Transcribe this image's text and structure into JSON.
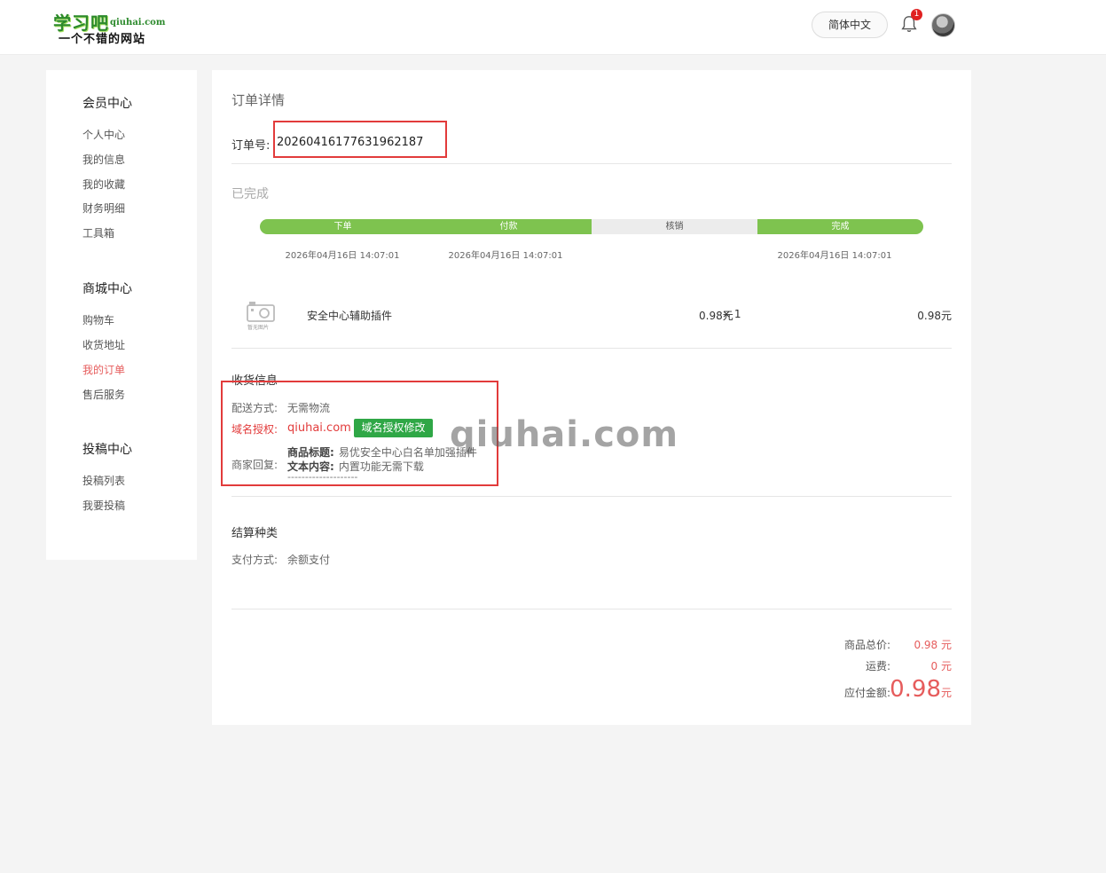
{
  "header": {
    "logo_main": "学习吧",
    "logo_domain": "qiuhai.com",
    "logo_slogan": "一个不错的网站",
    "language": "简体中文",
    "notification_count": "1"
  },
  "sidebar": {
    "groups": [
      {
        "title": "会员中心",
        "items": [
          "个人中心",
          "我的信息",
          "我的收藏",
          "财务明细",
          "工具箱"
        ]
      },
      {
        "title": "商城中心",
        "items": [
          "购物车",
          "收货地址",
          "我的订单",
          "售后服务"
        ]
      },
      {
        "title": "投稿中心",
        "items": [
          "投稿列表",
          "我要投稿"
        ]
      }
    ],
    "active_item": "我的订单"
  },
  "order": {
    "title": "订单详情",
    "order_no_label": "订单号:",
    "order_no": "20260416177631962187",
    "status": "已完成",
    "steps": [
      {
        "label": "下单",
        "time": "2026年04月16日 14:07:01",
        "done": true
      },
      {
        "label": "付款",
        "time": "2026年04月16日 14:07:01",
        "done": true
      },
      {
        "label": "核销",
        "time": "",
        "done": false
      },
      {
        "label": "完成",
        "time": "2026年04月16日 14:07:01",
        "done": true
      }
    ],
    "product": {
      "image_caption": "暂无图片",
      "name": "安全中心辅助插件",
      "unit_price": "0.98元",
      "quantity": "× 1",
      "total": "0.98元"
    }
  },
  "shipping": {
    "title": "收货信息",
    "delivery_label": "配送方式:",
    "delivery_value": "无需物流",
    "domain_label": "域名授权:",
    "domain_value": "qiuhai.com",
    "domain_button": "域名授权修改",
    "reply_label": "商家回复:",
    "reply_title_label": "商品标题:",
    "reply_title_value": "易优安全中心白名单加强插件",
    "reply_content_label": "文本内容:",
    "reply_content_value": "内置功能无需下载",
    "reply_separator": "--------------------"
  },
  "settlement": {
    "title": "结算种类",
    "pay_label": "支付方式:",
    "pay_value": "余额支付"
  },
  "summary": {
    "goods_total_label": "商品总价:",
    "goods_total_value": "0.98 元",
    "freight_label": "运费:",
    "freight_value": "0 元",
    "payable_label": "应付金额:",
    "payable_amount": "0.98",
    "payable_unit": "元"
  },
  "watermark": "qiuhai.com",
  "colors": {
    "accent_green": "#7ec34f",
    "button_green": "#2fa746",
    "price_red": "#e65c5c",
    "highlight_red": "#e23b3b"
  }
}
